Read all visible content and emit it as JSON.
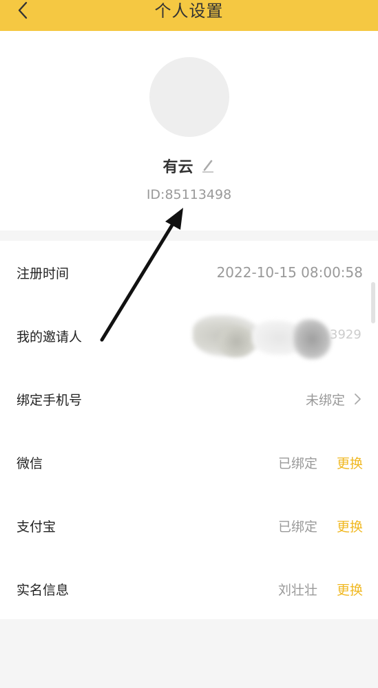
{
  "header": {
    "title": "个人设置",
    "background": "#f5c842"
  },
  "profile": {
    "name": "有云",
    "id_text": "ID:85113498"
  },
  "settings": {
    "register_time": {
      "label": "注册时间",
      "value": "2022-10-15 08:00:58"
    },
    "inviter": {
      "label": "我的邀请人",
      "value_visible_suffix": "3929"
    },
    "phone": {
      "label": "绑定手机号",
      "value": "未绑定"
    },
    "wechat": {
      "label": "微信",
      "value": "已绑定",
      "action": "更换"
    },
    "alipay": {
      "label": "支付宝",
      "value": "已绑定",
      "action": "更换"
    },
    "realname": {
      "label": "实名信息",
      "value": "刘壮壮",
      "action": "更换"
    }
  },
  "colors": {
    "accent": "#f0b822",
    "muted": "#999999"
  }
}
